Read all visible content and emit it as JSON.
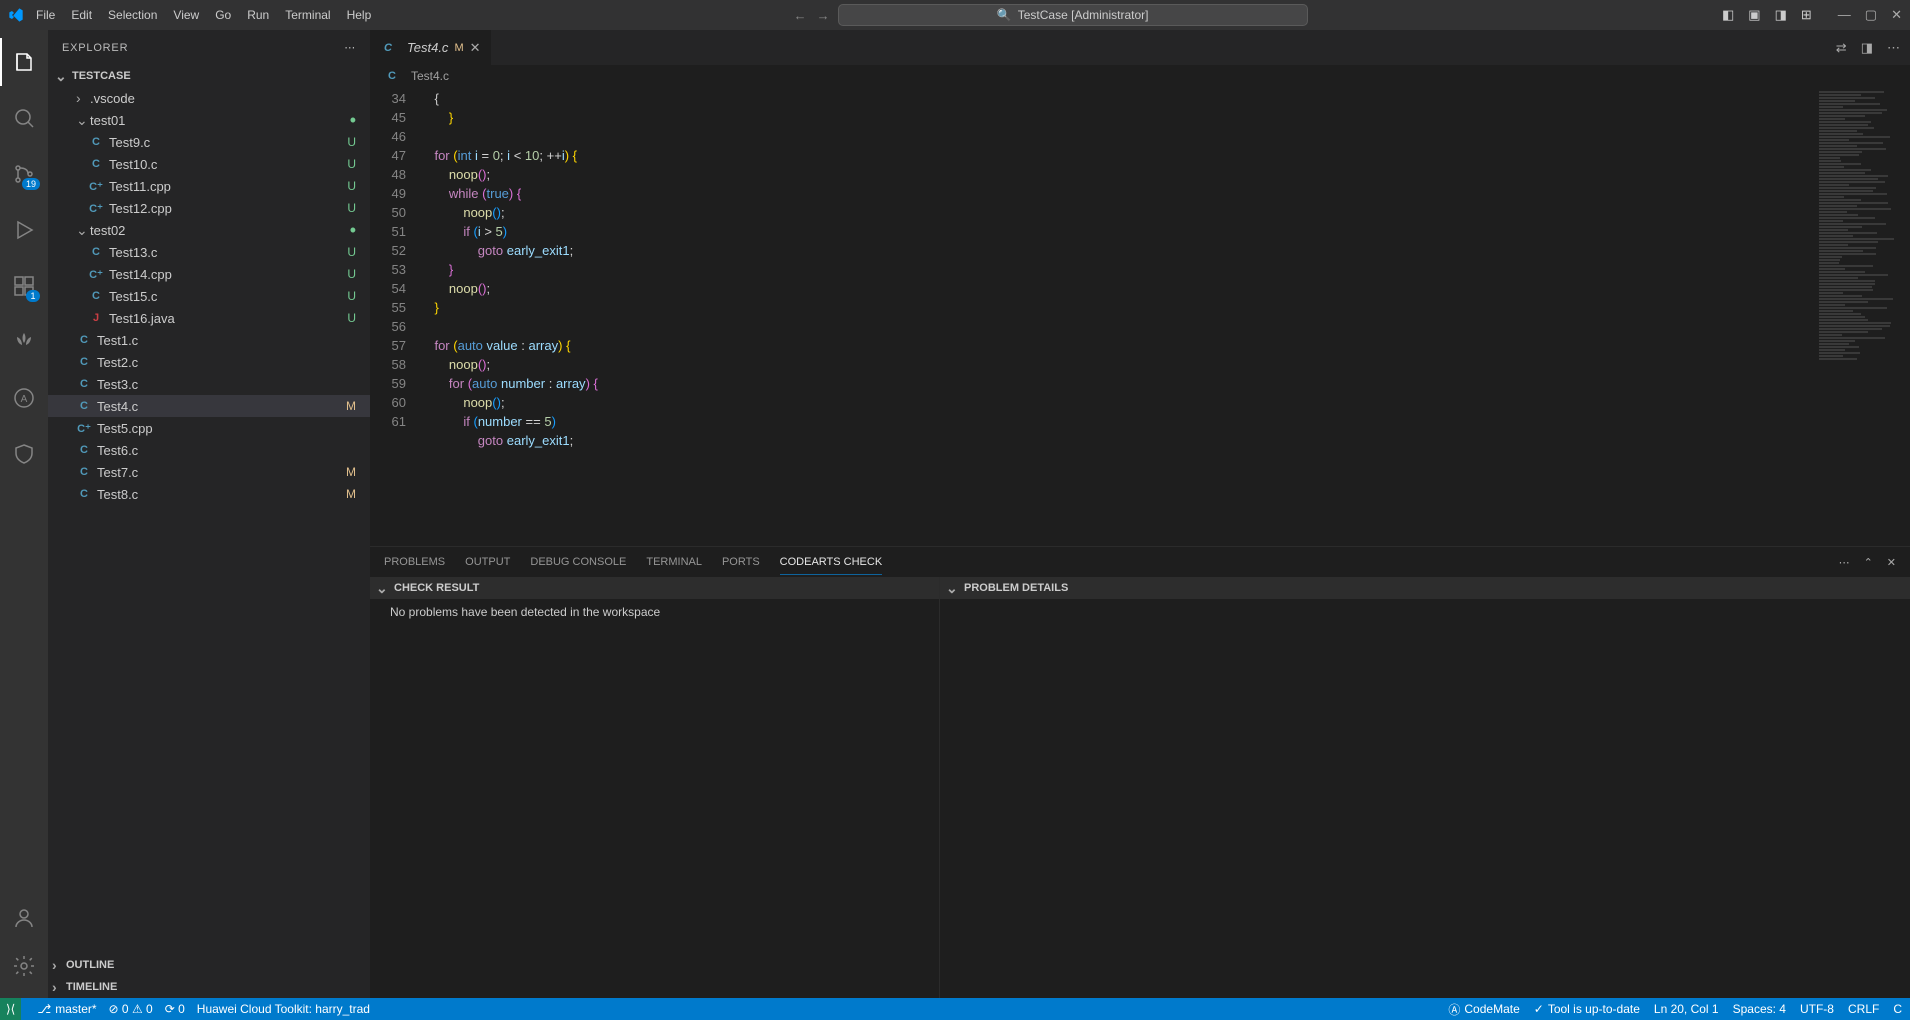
{
  "menu": [
    "File",
    "Edit",
    "Selection",
    "View",
    "Go",
    "Run",
    "Terminal",
    "Help"
  ],
  "search_center": "TestCase [Administrator]",
  "explorer": {
    "title": "EXPLORER",
    "workspace": "TESTCASE",
    "tree": [
      {
        "type": "folder",
        "name": ".vscode",
        "indent": 1,
        "expanded": false,
        "decor": ""
      },
      {
        "type": "folder",
        "name": "test01",
        "indent": 1,
        "expanded": true,
        "decor": "dot"
      },
      {
        "type": "file",
        "name": "Test9.c",
        "icon": "C",
        "iconcls": "fi-c",
        "indent": 2,
        "decor": "U"
      },
      {
        "type": "file",
        "name": "Test10.c",
        "icon": "C",
        "iconcls": "fi-c",
        "indent": 2,
        "decor": "U"
      },
      {
        "type": "file",
        "name": "Test11.cpp",
        "icon": "C⁺",
        "iconcls": "fi-cpp",
        "indent": 2,
        "decor": "U"
      },
      {
        "type": "file",
        "name": "Test12.cpp",
        "icon": "C⁺",
        "iconcls": "fi-cpp",
        "indent": 2,
        "decor": "U"
      },
      {
        "type": "folder",
        "name": "test02",
        "indent": 1,
        "expanded": true,
        "decor": "dot"
      },
      {
        "type": "file",
        "name": "Test13.c",
        "icon": "C",
        "iconcls": "fi-c",
        "indent": 2,
        "decor": "U"
      },
      {
        "type": "file",
        "name": "Test14.cpp",
        "icon": "C⁺",
        "iconcls": "fi-cpp",
        "indent": 2,
        "decor": "U"
      },
      {
        "type": "file",
        "name": "Test15.c",
        "icon": "C",
        "iconcls": "fi-c",
        "indent": 2,
        "decor": "U"
      },
      {
        "type": "file",
        "name": "Test16.java",
        "icon": "J",
        "iconcls": "fi-j",
        "indent": 2,
        "decor": "U"
      },
      {
        "type": "file",
        "name": "Test1.c",
        "icon": "C",
        "iconcls": "fi-c",
        "indent": 1,
        "decor": ""
      },
      {
        "type": "file",
        "name": "Test2.c",
        "icon": "C",
        "iconcls": "fi-c",
        "indent": 1,
        "decor": ""
      },
      {
        "type": "file",
        "name": "Test3.c",
        "icon": "C",
        "iconcls": "fi-c",
        "indent": 1,
        "decor": ""
      },
      {
        "type": "file",
        "name": "Test4.c",
        "icon": "C",
        "iconcls": "fi-c",
        "indent": 1,
        "decor": "M",
        "selected": true
      },
      {
        "type": "file",
        "name": "Test5.cpp",
        "icon": "C⁺",
        "iconcls": "fi-cpp",
        "indent": 1,
        "decor": ""
      },
      {
        "type": "file",
        "name": "Test6.c",
        "icon": "C",
        "iconcls": "fi-c",
        "indent": 1,
        "decor": ""
      },
      {
        "type": "file",
        "name": "Test7.c",
        "icon": "C",
        "iconcls": "fi-c",
        "indent": 1,
        "decor": "M"
      },
      {
        "type": "file",
        "name": "Test8.c",
        "icon": "C",
        "iconcls": "fi-c",
        "indent": 1,
        "decor": "M"
      }
    ],
    "outline": "OUTLINE",
    "timeline": "TIMELINE"
  },
  "activity": {
    "scm_badge": "19",
    "ext_badge": "1"
  },
  "editor": {
    "tab_icon": "C",
    "tab_name": "Test4.c",
    "tab_modified": "M",
    "breadcrumb_icon": "C",
    "breadcrumb": "Test4.c",
    "sticky_line": "34",
    "sticky_code": "    {",
    "lines": [
      {
        "n": "",
        "html": "        <span class='paren'>}</span>"
      },
      {
        "n": "45",
        "html": ""
      },
      {
        "n": "46",
        "html": "    <span class='kw'>for</span> <span class='paren'>(</span><span class='type'>int</span> <span class='ident'>i</span> <span class='op'>=</span> <span class='num'>0</span><span class='op'>;</span> <span class='ident'>i</span> <span class='op'>&lt;</span> <span class='num'>10</span><span class='op'>;</span> <span class='op'>++</span><span class='ident'>i</span><span class='paren'>)</span> <span class='paren'>{</span>"
      },
      {
        "n": "47",
        "html": "        <span class='fn'>noop</span><span class='paren2'>(</span><span class='paren2'>)</span><span class='op'>;</span>"
      },
      {
        "n": "48",
        "html": "        <span class='kw'>while</span> <span class='paren2'>(</span><span class='type'>true</span><span class='paren2'>)</span> <span class='paren2'>{</span>"
      },
      {
        "n": "49",
        "html": "            <span class='fn'>noop</span><span class='paren3'>(</span><span class='paren3'>)</span><span class='op'>;</span>"
      },
      {
        "n": "50",
        "html": "            <span class='kw'>if</span> <span class='paren3'>(</span><span class='ident'>i</span> <span class='op'>&gt;</span> <span class='num'>5</span><span class='paren3'>)</span>"
      },
      {
        "n": "51",
        "html": "                <span class='kw'>goto</span> <span class='ident'>early_exit1</span><span class='op'>;</span>"
      },
      {
        "n": "52",
        "html": "        <span class='paren2'>}</span>"
      },
      {
        "n": "53",
        "html": "        <span class='fn'>noop</span><span class='paren2'>(</span><span class='paren2'>)</span><span class='op'>;</span>"
      },
      {
        "n": "54",
        "html": "    <span class='paren'>}</span>"
      },
      {
        "n": "55",
        "html": ""
      },
      {
        "n": "56",
        "html": "    <span class='kw'>for</span> <span class='paren'>(</span><span class='type'>auto</span> <span class='ident'>value</span> <span class='op'>:</span> <span class='ident'>array</span><span class='paren'>)</span> <span class='paren'>{</span>"
      },
      {
        "n": "57",
        "html": "        <span class='fn'>noop</span><span class='paren2'>(</span><span class='paren2'>)</span><span class='op'>;</span>"
      },
      {
        "n": "58",
        "html": "        <span class='kw'>for</span> <span class='paren2'>(</span><span class='type'>auto</span> <span class='ident'>number</span> <span class='op'>:</span> <span class='ident'>array</span><span class='paren2'>)</span> <span class='paren2'>{</span>"
      },
      {
        "n": "59",
        "html": "            <span class='fn'>noop</span><span class='paren3'>(</span><span class='paren3'>)</span><span class='op'>;</span>"
      },
      {
        "n": "60",
        "html": "            <span class='kw'>if</span> <span class='paren3'>(</span><span class='ident'>number</span> <span class='op'>==</span> <span class='num'>5</span><span class='paren3'>)</span>"
      },
      {
        "n": "61",
        "html": "                <span class='kw'>goto</span> <span class='ident'>early_exit1</span><span class='op'>;</span>"
      }
    ]
  },
  "panel": {
    "tabs": [
      "PROBLEMS",
      "OUTPUT",
      "DEBUG CONSOLE",
      "TERMINAL",
      "PORTS",
      "CODEARTS CHECK"
    ],
    "active_tab": 5,
    "check_result_title": "CHECK RESULT",
    "check_result_msg": "No problems have been detected in the workspace",
    "problem_details_title": "PROBLEM DETAILS"
  },
  "status": {
    "branch": "master*",
    "errors_warnings": "⊘ 0  ⚠ 0",
    "ports": "⟳ 0",
    "toolkit": "Huawei Cloud Toolkit: harry_trad",
    "codemate": "CodeMate",
    "tool_status": "Tool is up-to-date",
    "cursor": "Ln 20, Col 1",
    "spaces": "Spaces: 4",
    "encoding": "UTF-8",
    "eol": "CRLF",
    "lang": "C"
  }
}
